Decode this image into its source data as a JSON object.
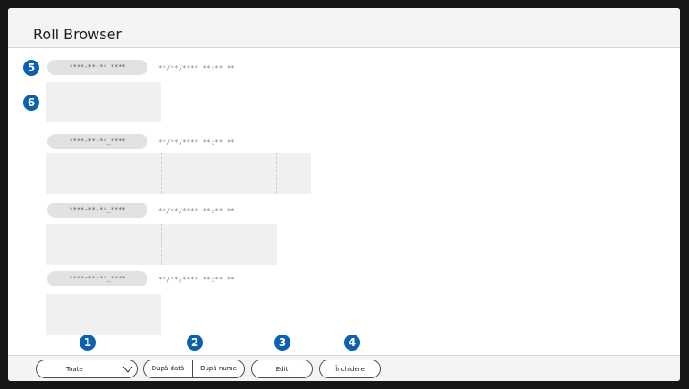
{
  "app": {
    "title": "Roll Browser"
  },
  "rolls": [
    {
      "name": "****-**-**_****",
      "date": "**/**/**** **:** **"
    },
    {
      "name": "****-**-**_****",
      "date": "**/**/**** **:** **"
    },
    {
      "name": "****-**-**_****",
      "date": "**/**/**** **:** **"
    },
    {
      "name": "****-**-**_****",
      "date": "**/**/**** **:** **"
    }
  ],
  "markers": [
    "5",
    "6",
    "1",
    "2",
    "3",
    "4"
  ],
  "footer": {
    "filter_value": "Toate",
    "sort_by_date": "După dată",
    "sort_by_name": "După nume",
    "edit": "Edit",
    "close": "Închidere"
  },
  "colors": {
    "marker": "#0d60b0",
    "background": "#ffffff",
    "bezel": "#161616"
  },
  "icons": {
    "dropdown": "chevron-down-icon"
  }
}
